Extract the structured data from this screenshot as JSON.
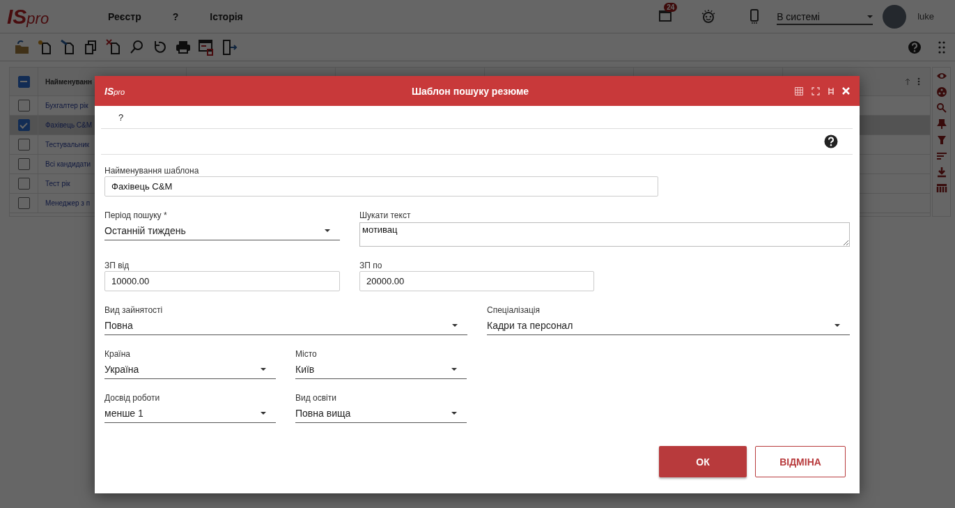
{
  "header": {
    "logo": "**IS**pro",
    "menu": [
      "Реєстр",
      "?",
      "Історія"
    ],
    "notification_count": "24",
    "status": {
      "value": "В системі"
    },
    "user": {
      "name": "luke"
    }
  },
  "grid": {
    "select_all": {
      "checked": true,
      "partial": true
    },
    "columns": [
      {
        "label": "Найменуванн"
      }
    ],
    "rows": [
      {
        "name": "Бухгалтер рік",
        "checked": false,
        "selected": false
      },
      {
        "name": "Фахівець C&M",
        "checked": true,
        "selected": true
      },
      {
        "name": "Тестувальник",
        "checked": false,
        "selected": false
      },
      {
        "name": "Всі кандидати",
        "checked": false,
        "selected": false
      },
      {
        "name": "Тест рік",
        "checked": false,
        "selected": false
      },
      {
        "name": "Менеджер з п",
        "checked": false,
        "selected": false
      }
    ]
  },
  "dialog": {
    "logo": "**IS**pro",
    "title": "Шаблон пошуку резюме",
    "menu": [
      "?"
    ],
    "rows": [
      [
        {
          "kind": "text",
          "label": "Найменування шаблона",
          "value": "Фахівець C&M"
        }
      ],
      [
        {
          "kind": "select",
          "label": "Період пошуку *",
          "value": "Останній тиждень"
        },
        {
          "kind": "textarea",
          "label": "Шукати текст",
          "value": "мотивац"
        }
      ],
      [
        {
          "kind": "text",
          "label": "ЗП від",
          "value": "10000.00"
        },
        {
          "kind": "text",
          "label": "ЗП по",
          "value": "20000.00"
        }
      ],
      [
        {
          "kind": "select",
          "label": "Вид зайнятості",
          "value": "Повна"
        },
        {
          "kind": "select",
          "label": "Спеціалізація",
          "value": "Кадри та персонал"
        }
      ],
      [
        {
          "kind": "select",
          "label": "Країна",
          "value": "Україна"
        },
        {
          "kind": "select",
          "label": "Місто",
          "value": "Київ"
        }
      ],
      [
        {
          "kind": "select",
          "label": "Досвід роботи",
          "value": "менше 1"
        },
        {
          "kind": "select",
          "label": "Вид освіти",
          "value": "Повна вища"
        }
      ]
    ],
    "buttons": [
      {
        "label": "ОК",
        "kind": "primary"
      },
      {
        "label": "ВІДМІНА",
        "kind": "secondary"
      }
    ]
  }
}
